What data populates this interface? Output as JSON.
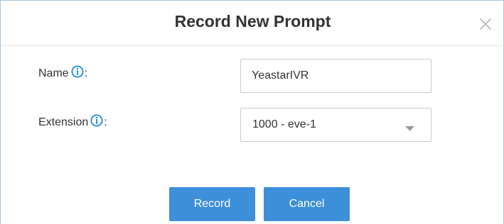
{
  "dialog": {
    "title": "Record New Prompt",
    "close_icon": "close-icon"
  },
  "form": {
    "name": {
      "label": "Name",
      "suffix": ":",
      "icon": "info-icon",
      "value": "YeastarIVR"
    },
    "extension": {
      "label": "Extension",
      "suffix": ":",
      "icon": "info-icon",
      "selected": "1000 - eve-1",
      "caret_icon": "caret-down-icon"
    }
  },
  "buttons": {
    "record_label": "Record",
    "cancel_label": "Cancel"
  },
  "colors": {
    "accent": "#3e8fd9",
    "info_icon": "#1e88e5",
    "title_text": "#333333",
    "border": "#cccccc"
  }
}
